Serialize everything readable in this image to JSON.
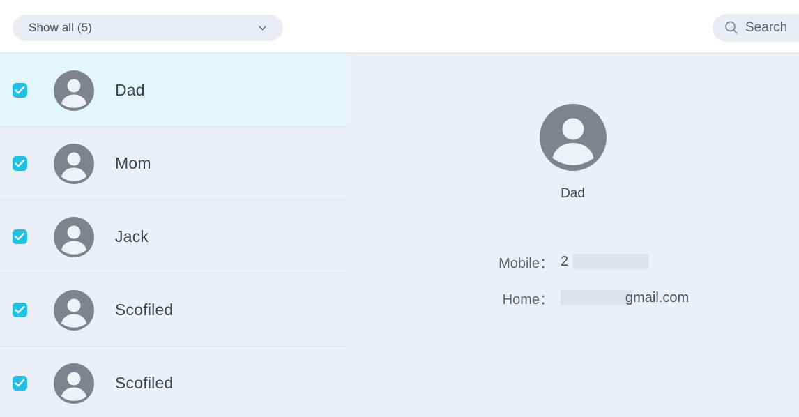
{
  "header": {
    "filter": {
      "label": "Show all (5)",
      "chevron_icon": "chevron-down-icon"
    },
    "search": {
      "label": "Search",
      "icon": "search-icon"
    }
  },
  "list": {
    "items": [
      {
        "name": "Dad",
        "checked": true,
        "selected": true
      },
      {
        "name": "Mom",
        "checked": true,
        "selected": false
      },
      {
        "name": "Jack",
        "checked": true,
        "selected": false
      },
      {
        "name": "Scofiled",
        "checked": true,
        "selected": false
      },
      {
        "name": "Scofiled",
        "checked": true,
        "selected": false
      }
    ]
  },
  "detail": {
    "avatar_icon": "user-avatar-icon",
    "name": "Dad",
    "fields": [
      {
        "label": "Mobile：",
        "value_prefix": "2",
        "value_suffix": "",
        "redacted": true
      },
      {
        "label": "Home：",
        "value_prefix": "",
        "value_suffix": "gmail.com",
        "redacted": true
      }
    ]
  },
  "colors": {
    "accent": "#22c0e0",
    "selected_row": "#e3f7fa",
    "panel_background": "#ecf0f6",
    "header_background": "#ffffff",
    "control_background": "#e9edf3",
    "avatar_gray": "#7f838d",
    "redaction_gray": "#dfe2e8"
  }
}
